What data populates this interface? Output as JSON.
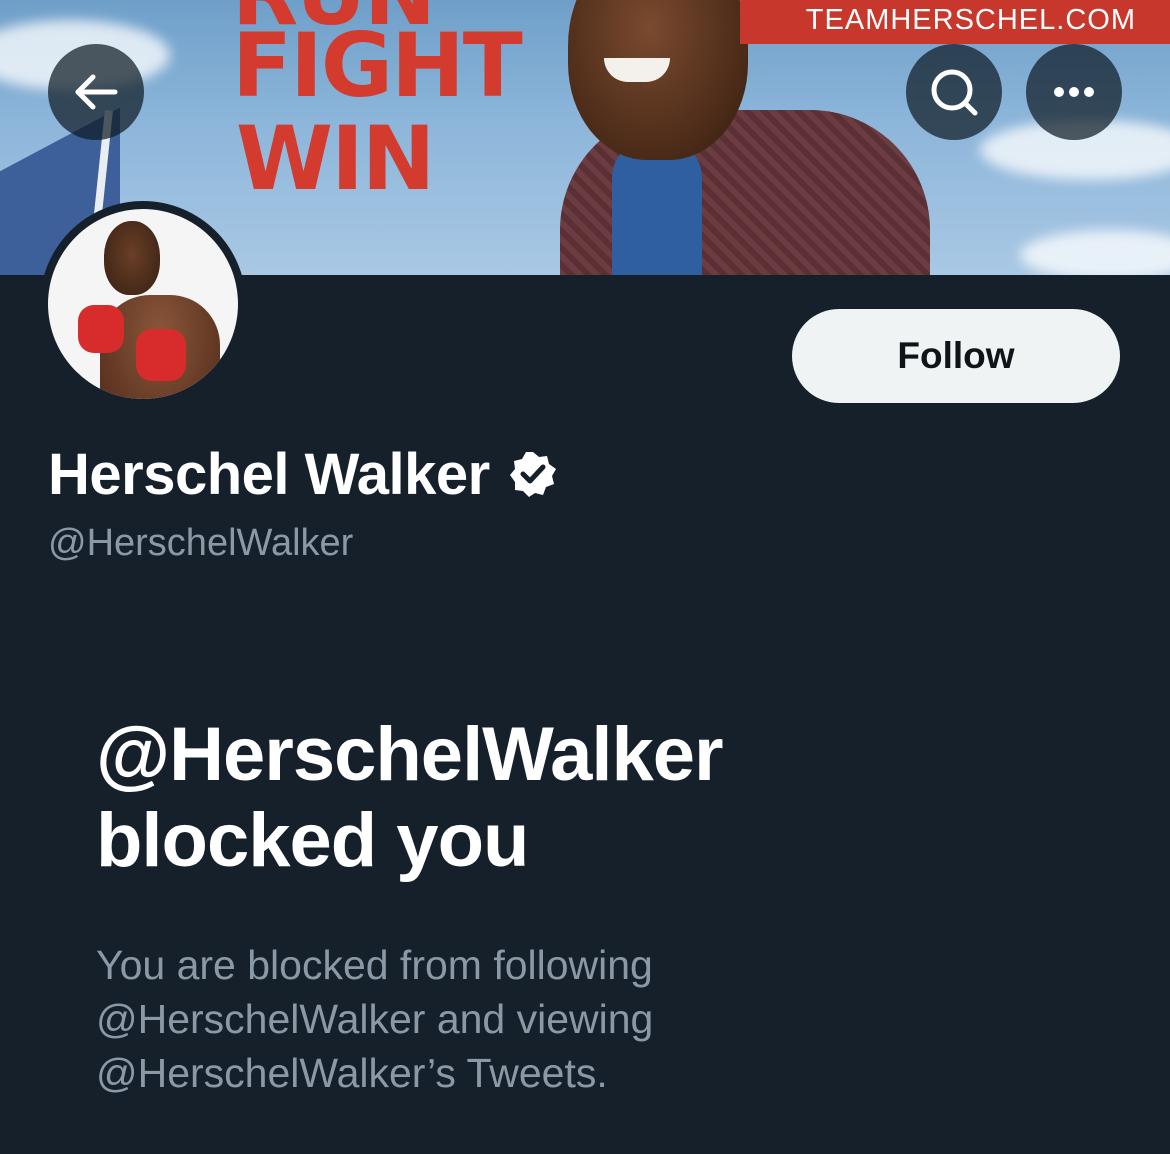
{
  "banner": {
    "slogan_top": "RUN",
    "slogan_line_1": "FIGHT",
    "slogan_line_2": "WIN",
    "website": "TEAMHERSCHEL.COM"
  },
  "header": {
    "back_icon": "arrow-left-icon",
    "search_icon": "search-icon",
    "more_icon": "more-horizontal-icon"
  },
  "profile": {
    "display_name": "Herschel Walker",
    "verified_icon": "verified-badge-icon",
    "handle": "@HerschelWalker",
    "follow_label": "Follow"
  },
  "blocked": {
    "title_line_1": "@HerschelWalker",
    "title_line_2": "blocked you",
    "description_line_1": "You are blocked from following",
    "description_line_2": "@HerschelWalker and viewing",
    "description_line_3": "@HerschelWalker’s Tweets."
  },
  "colors": {
    "background": "#15202b",
    "primary_text": "#ffffff",
    "secondary_text": "#8b98a5",
    "follow_button_bg": "#eff3f4",
    "banner_red": "#d23b2e"
  }
}
